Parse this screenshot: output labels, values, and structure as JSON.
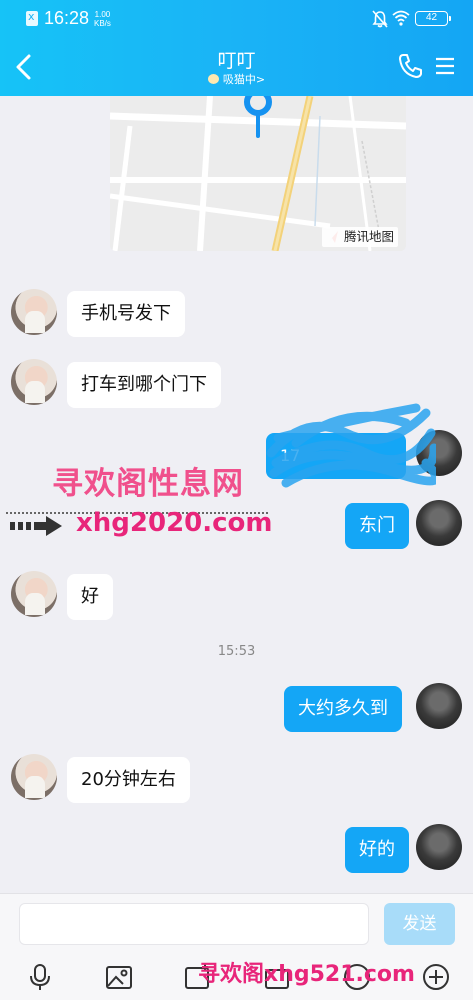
{
  "status_bar": {
    "time": "16:28",
    "speed_value": "1.00",
    "speed_unit": "KB/s",
    "battery": "42"
  },
  "header": {
    "title": "叮叮",
    "subtitle": "吸猫中",
    "subtitle_chevron": ">"
  },
  "map": {
    "label": "腾讯地图"
  },
  "messages": [
    {
      "side": "in",
      "text": "手机号发下"
    },
    {
      "side": "in",
      "text": "打车到哪个门下"
    },
    {
      "side": "out",
      "text": "17"
    },
    {
      "side": "out",
      "text": "东门"
    },
    {
      "side": "in",
      "text": "好"
    },
    {
      "side": "out",
      "text": "大约多久到"
    },
    {
      "side": "in",
      "text": "20分钟左右"
    },
    {
      "side": "out",
      "text": "好的"
    }
  ],
  "timestamp": "15:53",
  "watermark": {
    "title": "寻欢阁性息网",
    "url": "xhg2020.com",
    "bottom": "寻欢阁xhg521.com"
  },
  "input": {
    "placeholder": "",
    "send_label": "发送"
  },
  "toolbar": {
    "icons": [
      "microphone-icon",
      "image-icon",
      "camera-icon",
      "file-icon",
      "emoji-icon",
      "plus-icon"
    ]
  },
  "colors": {
    "header": "#18b4f6",
    "outgoing_bubble": "#14a6f6",
    "send_button": "#a8dcf9",
    "background": "#efeff4"
  }
}
